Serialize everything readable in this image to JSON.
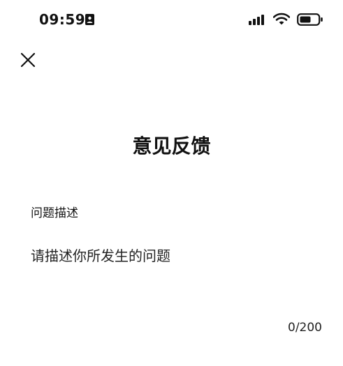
{
  "status_bar": {
    "time": "09:59",
    "icons": {
      "contact": "contact-card-icon",
      "signal": "cellular-signal-icon",
      "wifi": "wifi-icon",
      "battery": "battery-icon"
    }
  },
  "header": {
    "close_icon": "close-icon",
    "title": "意见反馈"
  },
  "form": {
    "section_label": "问题描述",
    "description": {
      "value": "",
      "placeholder": "请描述你所发生的问题"
    },
    "counter": "0/200"
  },
  "colors": {
    "background": "#ffffff",
    "text": "#111111"
  }
}
